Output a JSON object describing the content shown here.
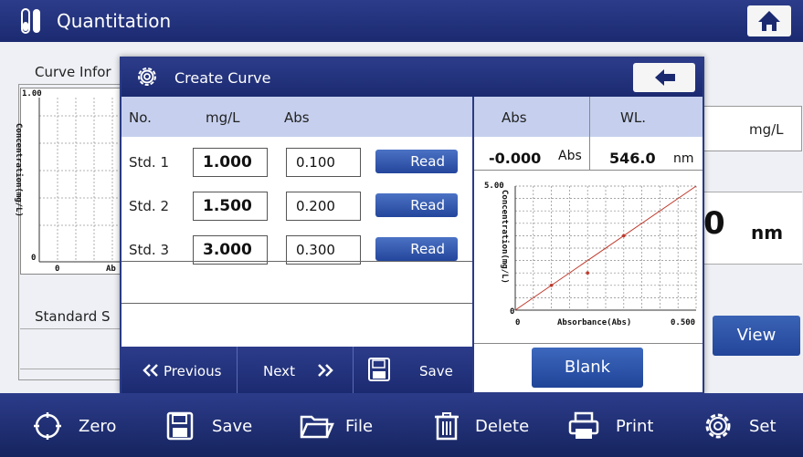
{
  "window": {
    "title": "Quantitation"
  },
  "background": {
    "curve_info_label": "Curve Infor",
    "chart_y_max": "1.00",
    "chart_y_label": "Concentration(mg/L)",
    "chart_origin": "0",
    "chart_x_origin": "0",
    "chart_x_partial": "Ab",
    "standard_label": "Standard S",
    "unit_mgl": "mg/L",
    "zero_digit": "0",
    "unit_nm": "nm",
    "view_label": "View"
  },
  "dialog": {
    "title": "Create Curve",
    "headers": {
      "no": "No.",
      "conc": "mg/L",
      "abs": "Abs",
      "abs_right": "Abs",
      "wl": "WL."
    },
    "rows": [
      {
        "no": "Std. 1",
        "conc": "1.000",
        "abs": "0.100",
        "read": "Read"
      },
      {
        "no": "Std. 2",
        "conc": "1.500",
        "abs": "0.200",
        "read": "Read"
      },
      {
        "no": "Std. 3",
        "conc": "3.000",
        "abs": "0.300",
        "read": "Read"
      }
    ],
    "current_abs": "-0.000",
    "abs_unit": "Abs",
    "wavelength": "546.0",
    "wl_unit": "nm",
    "nav": {
      "previous": "Previous",
      "next": "Next",
      "save": "Save"
    },
    "blank_label": "Blank"
  },
  "chart_data": {
    "type": "scatter",
    "title": "",
    "xlabel": "Absorbance(Abs)",
    "ylabel": "Concentration(mg/L)",
    "xlim": [
      0,
      0.5
    ],
    "ylim": [
      0,
      5.0
    ],
    "x_tick_labels": [
      "0",
      "0.500"
    ],
    "y_tick_labels": [
      "0",
      "5.00"
    ],
    "grid": true,
    "points": [
      {
        "x": 0.1,
        "y": 1.0
      },
      {
        "x": 0.2,
        "y": 1.5
      },
      {
        "x": 0.3,
        "y": 3.0
      }
    ],
    "fit_line": {
      "x": [
        0.0,
        0.5
      ],
      "y": [
        0.0,
        5.0
      ]
    },
    "line_color": "#c0392b"
  },
  "toolbar": {
    "items": [
      {
        "label": "Zero",
        "icon": "zero-target-icon"
      },
      {
        "label": "Save",
        "icon": "floppy-disk-icon"
      },
      {
        "label": "File",
        "icon": "folder-icon"
      },
      {
        "label": "Delete",
        "icon": "trash-icon"
      },
      {
        "label": "Print",
        "icon": "printer-icon"
      },
      {
        "label": "Set",
        "icon": "gear-icon"
      }
    ]
  },
  "colors": {
    "header_blue": "#1b2a70",
    "table_header": "#c6d0ee",
    "button_blue": "#24469c"
  }
}
